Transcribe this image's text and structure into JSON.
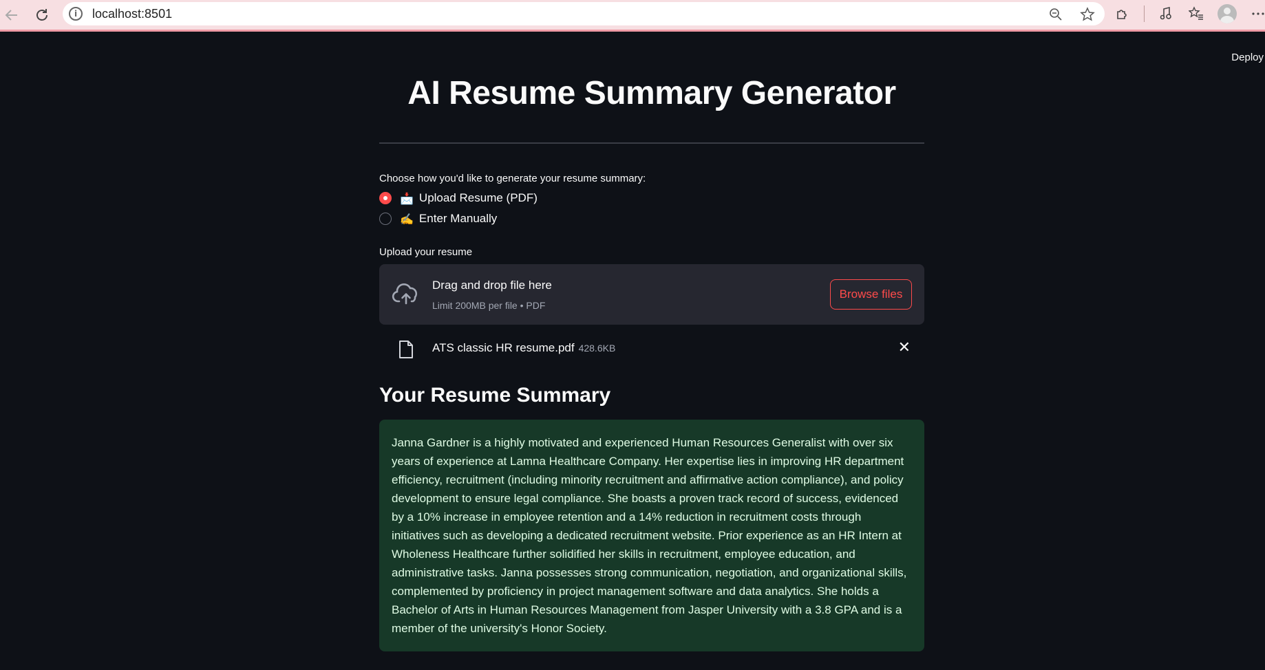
{
  "browser": {
    "url": "localhost:8501"
  },
  "app": {
    "deploy_label": "Deploy",
    "title": "AI Resume Summary Generator"
  },
  "input_mode": {
    "label": "Choose how you'd like to generate your resume summary:",
    "options": [
      {
        "emoji": "📩",
        "label": "Upload Resume (PDF)",
        "selected": true
      },
      {
        "emoji": "✍️",
        "label": "Enter Manually",
        "selected": false
      }
    ]
  },
  "uploader": {
    "label": "Upload your resume",
    "drop_title": "Drag and drop file here",
    "drop_subtitle": "Limit 200MB per file • PDF",
    "browse_label": "Browse files",
    "file": {
      "name": "ATS classic HR resume.pdf",
      "size": "428.6KB"
    }
  },
  "summary": {
    "heading": "Your Resume Summary",
    "text": "Janna Gardner is a highly motivated and experienced Human Resources Generalist with over six years of experience at Lamna Healthcare Company. Her expertise lies in improving HR department efficiency, recruitment (including minority recruitment and affirmative action compliance), and policy development to ensure legal compliance. She boasts a proven track record of success, evidenced by a 10% increase in employee retention and a 14% reduction in recruitment costs through initiatives such as developing a dedicated recruitment website. Prior experience as an HR Intern at Wholeness Healthcare further solidified her skills in recruitment, employee education, and administrative tasks. Janna possesses strong communication, negotiation, and organizational skills, complemented by proficiency in project management software and data analytics. She holds a Bachelor of Arts in Human Resources Management from Jasper University with a 3.8 GPA and is a member of the university's Honor Society."
  },
  "theme": {
    "background": "#0e1117",
    "accent": "#ff4b4b",
    "success_bg": "#173928"
  }
}
